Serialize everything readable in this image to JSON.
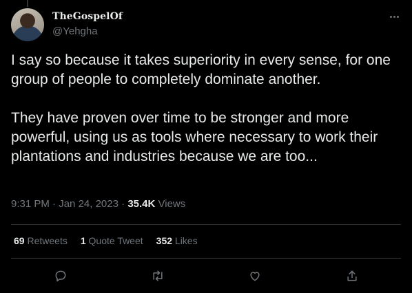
{
  "tweet": {
    "display_name": "TheGospelOf",
    "handle": "@Yehgha",
    "text": "I say so because it takes superiority in every sense, for one group of people to completely dominate another.\n\nThey have proven over time to be stronger and more powerful, using us as tools where necessary to work their plantations and industries because we are too...",
    "time": "9:31 PM",
    "date": "Jan 24, 2023",
    "views_count": "35.4K",
    "views_label": "Views"
  },
  "stats": {
    "retweets_count": "69",
    "retweets_label": "Retweets",
    "quotes_count": "1",
    "quotes_label": "Quote Tweet",
    "likes_count": "352",
    "likes_label": "Likes"
  },
  "icons": {
    "reply": "reply-icon",
    "retweet": "retweet-icon",
    "like": "like-icon",
    "share": "share-icon",
    "more": "more-icon"
  },
  "colors": {
    "background": "#000000",
    "text": "#e7e9ea",
    "muted": "#71767b",
    "divider": "#2f3336"
  }
}
